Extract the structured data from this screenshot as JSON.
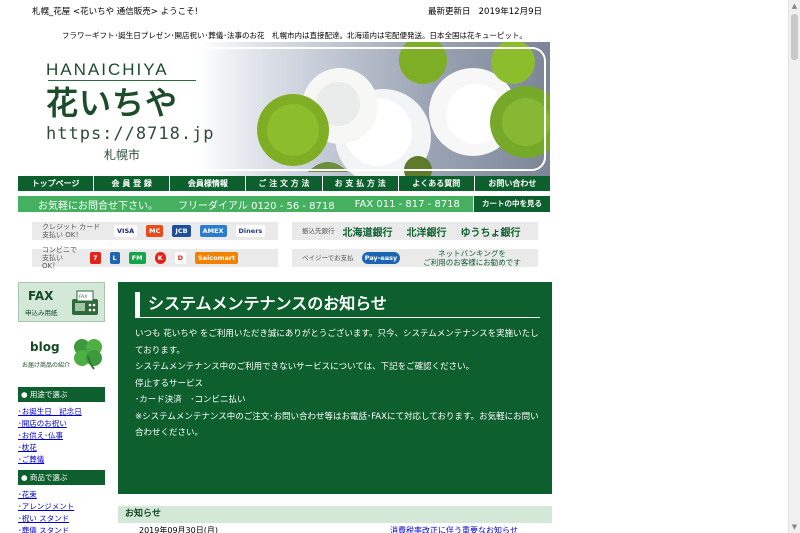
{
  "header": {
    "site_title": "札幌_花屋 <花いちや 通信販売> ようこそ!",
    "last_updated_label": "最新更新日",
    "last_updated_date": "2019年12月9日",
    "tagline": "フラワーギフト･誕生日プレゼン･開店祝い･葬儀･法事のお花　札幌市内は直接配達。北海道内は宅配便発送。日本全国は花キューピット。"
  },
  "banner": {
    "brand_en": "HANAICHIYA",
    "brand_jp": "花いちや",
    "url": "https://8718.jp",
    "city": "札幌市"
  },
  "nav": [
    {
      "label": "トップページ",
      "name": "top-page"
    },
    {
      "label": "会 員 登 録",
      "name": "member-register"
    },
    {
      "label": "会員様情報",
      "name": "member-info"
    },
    {
      "label": "ご 注 文 方 法",
      "name": "order-method"
    },
    {
      "label": "お 支 払 方 法",
      "name": "payment-method"
    },
    {
      "label": "よくある質問",
      "name": "faq"
    },
    {
      "label": "お問い合わせ",
      "name": "contact"
    }
  ],
  "contact_bar": {
    "prompt": "お気軽にお問合せ下さい。",
    "free_dial": "フリーダイアル 0120 - 56 - 8718",
    "fax": "FAX 011 - 817 - 8718",
    "cart_label": "カートの中を見る"
  },
  "payments": {
    "credit_label": "クレジット カード 支払い OK！",
    "credit_cards": [
      "VISA",
      "MC",
      "JCB",
      "AMEX",
      "Diners"
    ],
    "bank_label": "振込先銀行",
    "banks": [
      "北海道銀行",
      "北洋銀行",
      "ゆうちょ銀行"
    ],
    "convenience_label": "コンビニで 支払い OK！",
    "stores": [
      "7",
      "L",
      "FM",
      "K",
      "D",
      "Seicomart"
    ],
    "payeasy_label": "ペイジーでお支払",
    "payeasy_logo": "Pay-easy",
    "netbank_text_1": "ネットバンキングを",
    "netbank_text_2": "ご利用のお客様にお勧めです"
  },
  "sidebar": {
    "fax_title": "FAX",
    "fax_sub": "申込み用紙",
    "fax_icon_text": "FAX",
    "blog_title": "blog",
    "blog_sub": "お届け商品の紹介",
    "purpose_head": "● 用途で選ぶ",
    "purpose_items": [
      "･お誕生日　記念日",
      "･開店のお祝い",
      "･お供え･仏事",
      "･枕花",
      "･ご葬儀"
    ],
    "product_head": "● 商品で選ぶ",
    "product_items": [
      "･花束",
      "･アレンジメント",
      "･祝い スタンド",
      "･葬儀 スタンド"
    ]
  },
  "maintenance": {
    "title": "システムメンテナンスのお知らせ",
    "p1": "いつも 花いちや をご利用いただき誠にありがとうございます。只今、システムメンテナンスを実施いたしております。",
    "p2": "システムメンテナンス中のご利用できないサービスについては、下記をご確認ください。",
    "p3": "停止するサービス",
    "p4": "･カード決済　･コンビニ払い",
    "p5": "※システムメンテナンス中のご注文･お問い合わせ等はお電話･FAXにて対応しております。お気軽にお問い合わせください。"
  },
  "news": {
    "head": "お知らせ",
    "date": "2019年09月30日(月)",
    "link": "消費税率改正に伴う重要なお知らせ"
  },
  "colors": {
    "dark_green": "#0d5f2e",
    "mid_green": "#45b060",
    "pale_green": "#d4e8d7"
  }
}
